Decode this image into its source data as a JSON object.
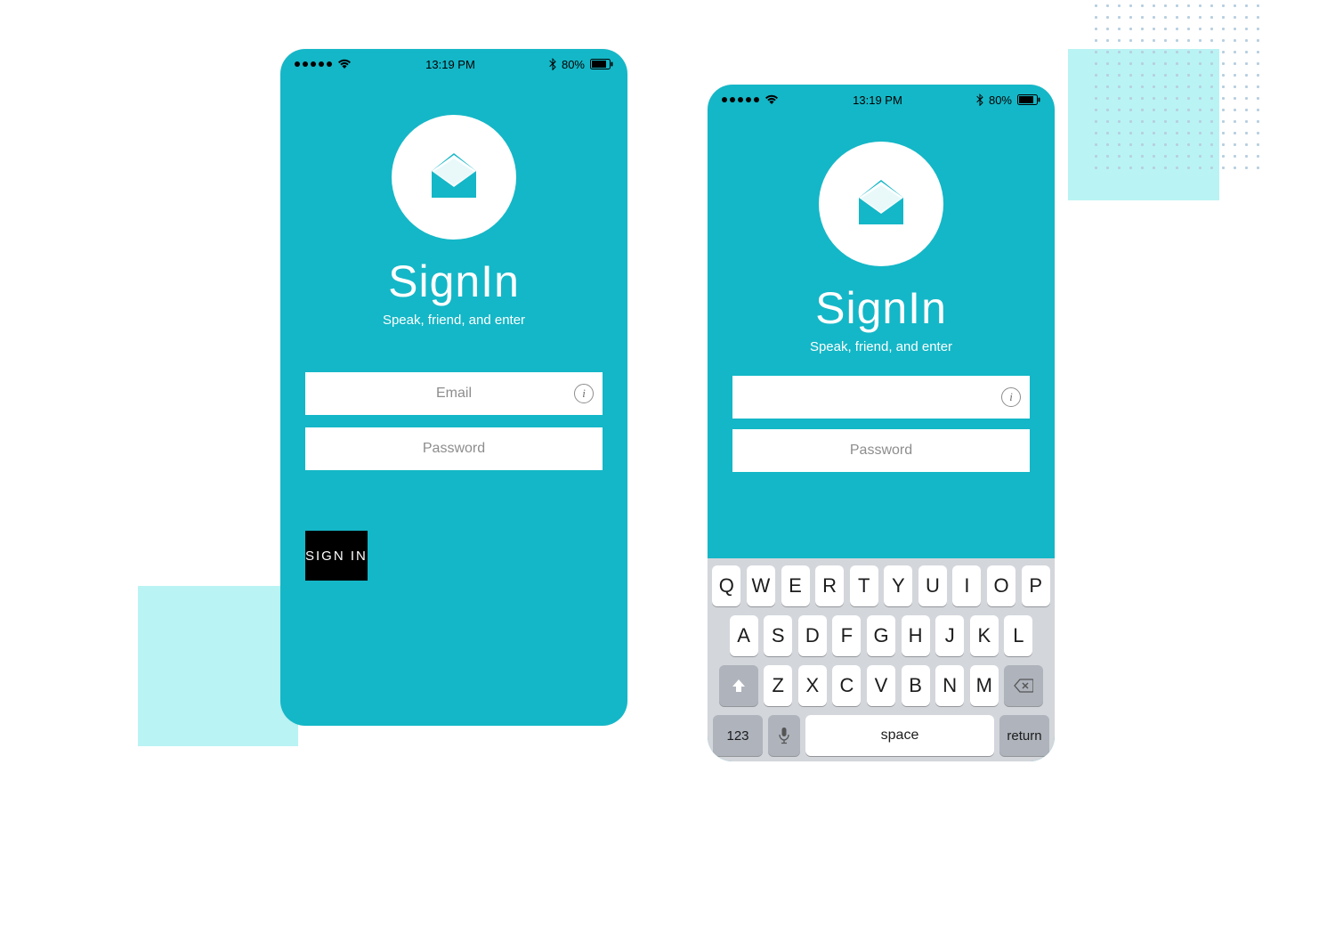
{
  "statusbar": {
    "time": "13:19 PM",
    "battery_pct": "80%"
  },
  "app": {
    "title": "SignIn",
    "subtitle": "Speak, friend, and enter"
  },
  "form": {
    "email_placeholder": "Email",
    "password_placeholder": "Password",
    "signin_button": "SIGN IN",
    "info_glyph": "i"
  },
  "keyboard": {
    "row1": [
      "Q",
      "W",
      "E",
      "R",
      "T",
      "Y",
      "U",
      "I",
      "O",
      "P"
    ],
    "row2": [
      "A",
      "S",
      "D",
      "F",
      "G",
      "H",
      "J",
      "K",
      "L"
    ],
    "row3": [
      "Z",
      "X",
      "C",
      "V",
      "B",
      "N",
      "M"
    ],
    "num_key": "123",
    "space_label": "space",
    "return_label": "return"
  },
  "colors": {
    "brand": "#14b7c7",
    "accent_light": "#baf3f4"
  }
}
